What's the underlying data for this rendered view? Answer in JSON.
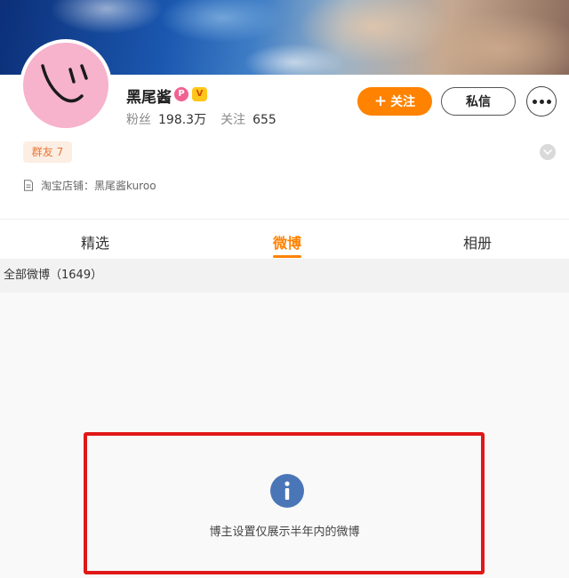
{
  "profile": {
    "name": "黑尾酱",
    "badge_1": "P",
    "badge_2": "V",
    "fans_label": "粉丝",
    "fans_count": "198.3万",
    "follow_label": "关注",
    "follow_count": "655",
    "fans_group_tag": "群友 7",
    "shop_text": "淘宝店铺：黑尾酱kuroo"
  },
  "actions": {
    "follow_plus": "+",
    "follow": "关注",
    "message": "私信"
  },
  "tabs": [
    {
      "label": "精选",
      "active": false
    },
    {
      "label": "微博",
      "active": true
    },
    {
      "label": "相册",
      "active": false
    }
  ],
  "feed": {
    "all_posts": "全部微博（1649）",
    "notice": "博主设置仅展示半年内的微博"
  },
  "colors": {
    "accent": "#ff8200",
    "avatar_bg": "#f6b3cb",
    "highlight_border": "#e01818",
    "info_icon": "#4a76b8"
  }
}
